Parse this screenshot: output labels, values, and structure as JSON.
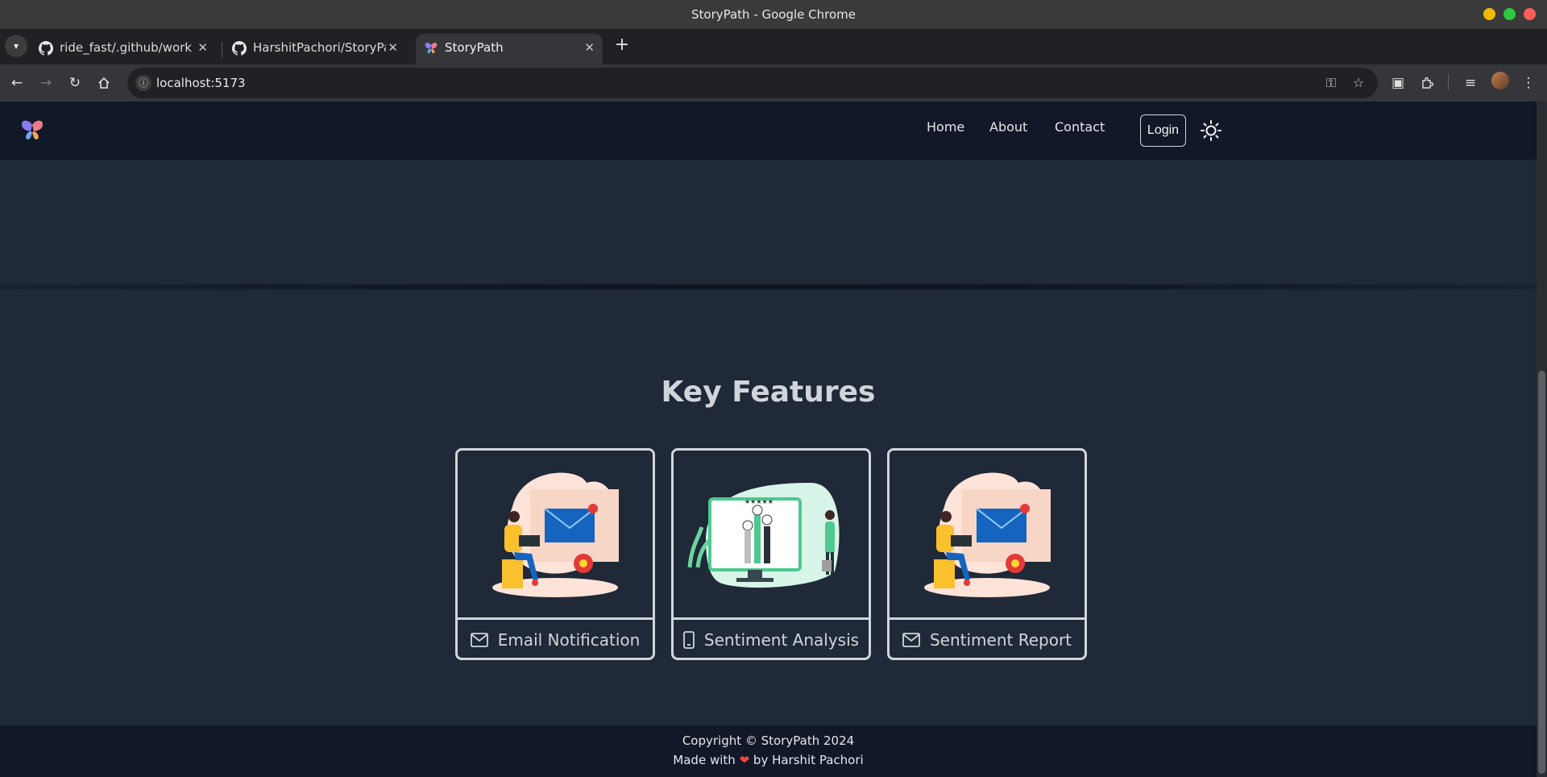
{
  "window": {
    "title": "StoryPath - Google Chrome",
    "dots": {
      "minimize_color": "#f5b800",
      "maximize_color": "#2ec840",
      "close_color": "#ff5f57"
    }
  },
  "tabs": [
    {
      "title": "ride_fast/.github/work",
      "favicon": "github-icon",
      "active": false
    },
    {
      "title": "HarshitPachori/StoryPa",
      "favicon": "github-icon",
      "active": false
    },
    {
      "title": "StoryPath",
      "favicon": "butterfly-logo",
      "active": true
    }
  ],
  "toolbar": {
    "url": "localhost:5173",
    "icons": [
      "back-icon",
      "forward-icon",
      "reload-icon",
      "home-icon",
      "key-icon",
      "star-icon",
      "tab-search-icon",
      "extensions-icon",
      "media-icon",
      "profile-avatar",
      "menu-icon"
    ]
  },
  "nav": {
    "links": [
      "Home",
      "About",
      "Contact"
    ],
    "login_label": "Login",
    "theme_icon": "sun-icon",
    "background": "#111827"
  },
  "features": {
    "title": "Key Features",
    "cards": [
      {
        "label": "Email Notification",
        "icon": "mail-icon",
        "illustration": "woman-laptop-email"
      },
      {
        "label": "Sentiment Analysis",
        "icon": "phone-icon",
        "illustration": "monitor-rating-chart"
      },
      {
        "label": "Sentiment Report",
        "icon": "mail-icon",
        "illustration": "woman-laptop-email"
      }
    ]
  },
  "footer": {
    "copyright": "Copyright © StoryPath 2024",
    "made_with": "Made with",
    "by": "by Harshit Pachori"
  },
  "colors": {
    "page_bg": "#1f2937",
    "nav_bg": "#111827",
    "card_border": "#d1d5db",
    "heart": "#ef4444"
  }
}
